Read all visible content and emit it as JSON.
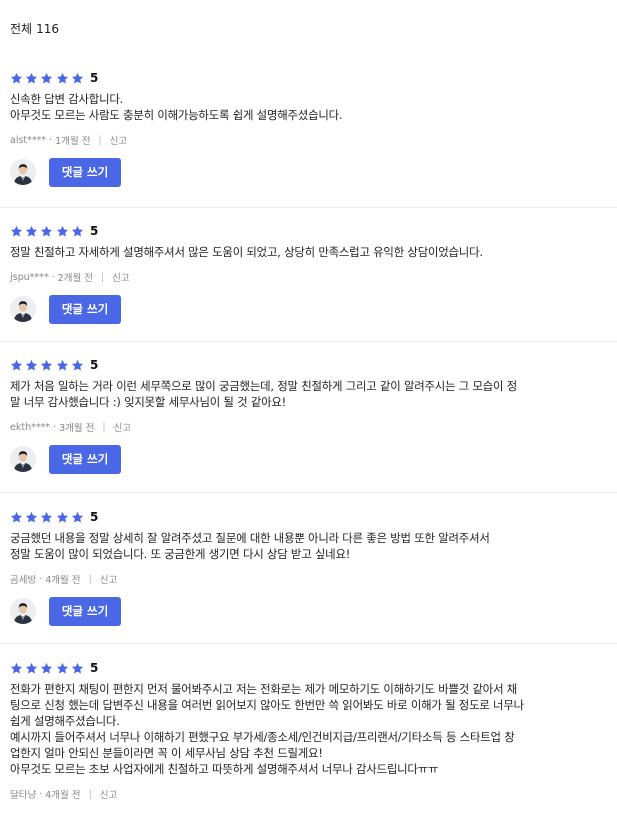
{
  "header": {
    "total_label": "전체",
    "total_count": "116"
  },
  "colors": {
    "star": "#4a67e6",
    "button": "#4a67e6"
  },
  "icons": {
    "star": "star-icon",
    "avatar": "user-avatar"
  },
  "reply_label": "댓글 쓰기",
  "reviews": [
    {
      "rating": "5",
      "text": "신속한 답변 감사합니다.\n아무것도 모르는 사람도 충분히 이해가능하도록 쉽게 설명해주셨습니다.",
      "author": "alst****",
      "time": "1개월 전",
      "report": "신고",
      "show_reply": true
    },
    {
      "rating": "5",
      "text": "정말 친절하고 자세하게 설명해주셔서 많은 도움이 되었고, 상당히 만족스럽고 유익한 상담이었습니다.",
      "author": "jspu****",
      "time": "2개월 전",
      "report": "신고",
      "show_reply": true
    },
    {
      "rating": "5",
      "text": "제가 처음 일하는 거라 이런 세무쪽으로 많이 궁금했는데, 정말 친절하게 그리고 같이 알려주시는 그 모습이 정\n말 너무 감사했습니다 :) 잊지못할 세무사님이 될 것 같아요!",
      "author": "ekth****",
      "time": "3개월 전",
      "report": "신고",
      "show_reply": true
    },
    {
      "rating": "5",
      "text": "궁금했던 내용을 정말 상세히 잘 알려주셨고 질문에 대한 내용뿐 아니라 다른 좋은 방법 또한 알려주셔서\n정말 도움이 많이 되었습니다. 또 궁금한게 생기면 다시 상담 받고 싶네요!",
      "author": "곰세방",
      "time": "4개월 전",
      "report": "신고",
      "show_reply": true
    },
    {
      "rating": "5",
      "text": "전화가 편한지 채팅이 편한지 먼저 물어봐주시고 저는 전화로는 제가 메모하기도 이해하기도 바쁠것 같아서 채\n팅으로 신청 했는데 답변주신 내용을 여러번 읽어보지 않아도 한번만 쓱 읽어봐도 바로 이해가 될 정도로 너무나\n쉽게 설명해주셨습니다.\n예시까지 들어주셔서 너무나 이해하기 편했구요 부가세/종소세/인건비지급/프리랜서/기타소득 등 스타트업 창\n업한지 얼마 안되신 분들이라면 꼭 이 세무사님 상담 추천 드릴게요!\n아무것도 모르는 초보 사업자에게 친절하고 따뜻하게 설명해주셔서 너무나 감사드립니다ㅠㅠ",
      "author": "달타냥",
      "time": "4개월 전",
      "report": "신고",
      "show_reply": false
    }
  ]
}
